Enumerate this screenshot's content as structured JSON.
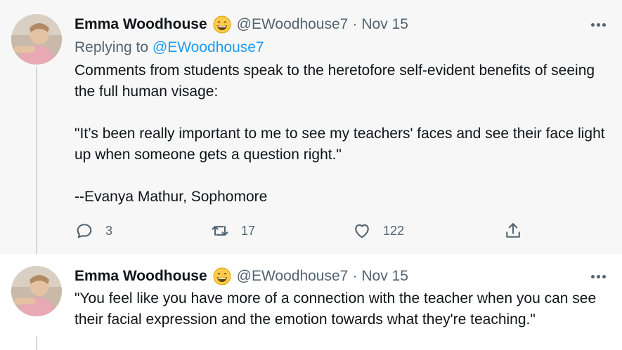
{
  "tweets": [
    {
      "author": {
        "name": "Emma Woodhouse",
        "handle": "@EWoodhouse7",
        "emoji": "grinning-face-emoji"
      },
      "date": "Nov 15",
      "replying_label": "Replying to",
      "replying_to": "@EWoodhouse7",
      "text": [
        "Comments from students speak to the heretofore self-evident benefits of seeing the full human visage:",
        "\"It’s been really important to me to see my teachers' faces and see their face light up when someone gets a question right.\"",
        "--Evanya Mathur, Sophomore"
      ],
      "actions": {
        "replies": "3",
        "retweets": "17",
        "likes": "122"
      }
    },
    {
      "author": {
        "name": "Emma Woodhouse",
        "handle": "@EWoodhouse7",
        "emoji": "grinning-face-emoji"
      },
      "date": "Nov 15",
      "text": [
        "\"You feel like you have more of a connection with the teacher when you can see their facial expression and the emotion towards what they're teaching.\""
      ]
    }
  ],
  "separator": "·",
  "colors": {
    "link": "#1d9bf0",
    "secondary": "#536471",
    "primary_text": "#0f1419",
    "highlight_bg": "#f7f7f7"
  }
}
